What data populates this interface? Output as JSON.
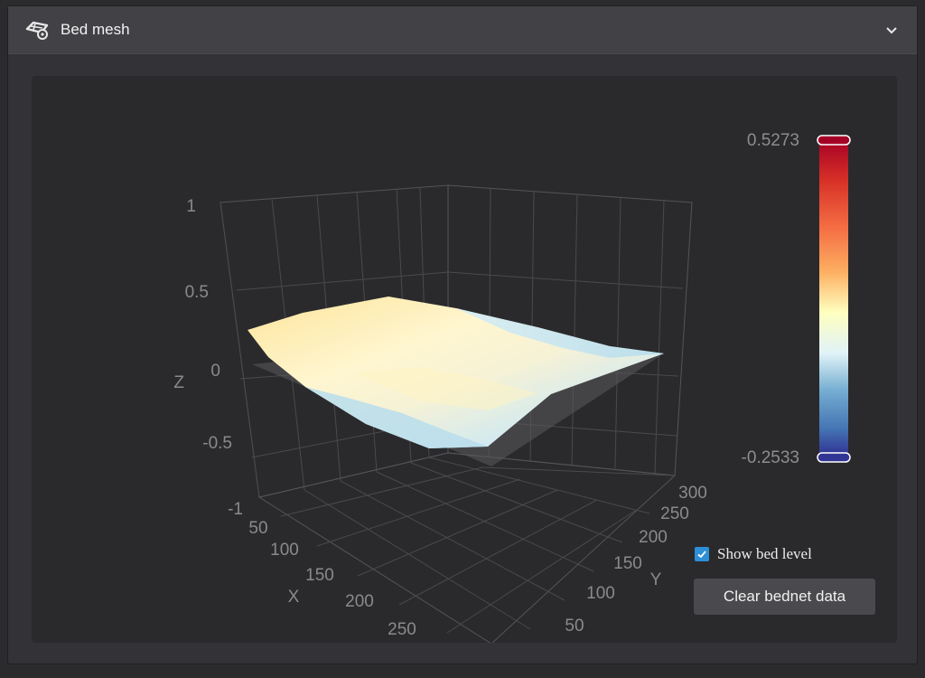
{
  "header": {
    "title": "Bed mesh",
    "icon": "bed-mesh-icon",
    "toggle_icon": "chevron-down-icon"
  },
  "chart_data": {
    "type": "surface3d",
    "title": "",
    "axes": {
      "x": {
        "label": "X",
        "ticks": [
          "50",
          "100",
          "150",
          "200",
          "250"
        ]
      },
      "y": {
        "label": "Y",
        "ticks": [
          "50",
          "100",
          "150",
          "200",
          "250",
          "300"
        ]
      },
      "z": {
        "label": "Z",
        "ticks": [
          "1",
          "0.5",
          "0",
          "-0.5",
          "-1"
        ],
        "zlim": [
          -1,
          1
        ]
      }
    },
    "visual_map": {
      "max_label": "0.5273",
      "min_label": "-0.2533",
      "max": 0.5273,
      "min": -0.2533
    },
    "colors": {
      "high": "#a50026",
      "mid_high": "#fdae61",
      "mid": "#ffffbf",
      "mid_low": "#abd9e9",
      "low": "#313695"
    }
  },
  "controls": {
    "show_bed_level_label": "Show bed level",
    "show_bed_level_checked": true,
    "clear_button_label": "Clear bednet data"
  }
}
